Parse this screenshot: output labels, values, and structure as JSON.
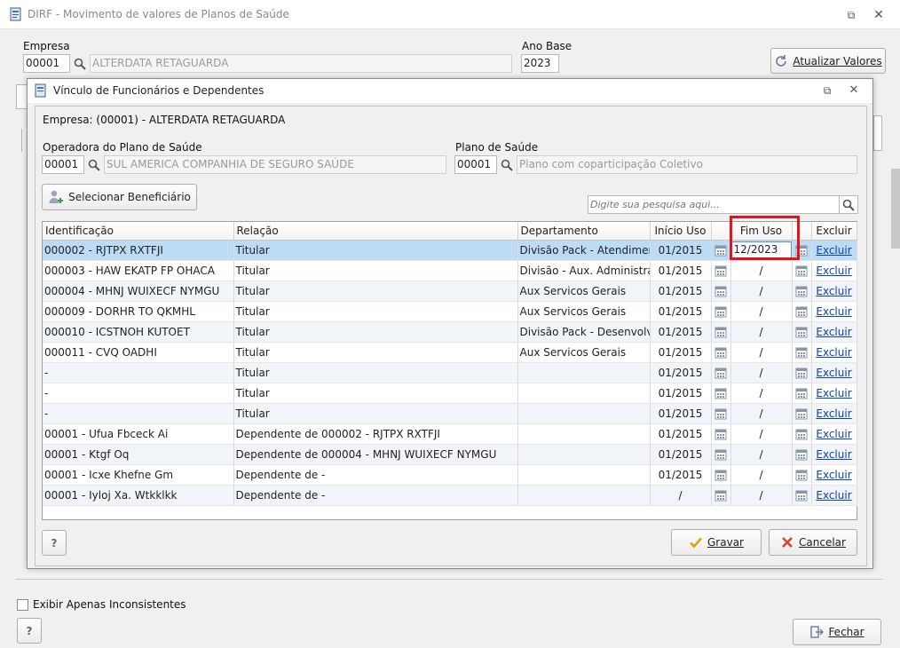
{
  "window": {
    "title": "DIRF - Movimento de valores de Planos de Saúde"
  },
  "main": {
    "empresa_label": "Empresa",
    "empresa_code": "00001",
    "empresa_name": "ALTERDATA RETAGUARDA",
    "ano_base_label": "Ano Base",
    "ano_base_value": "2023",
    "atualizar_label": "Atualizar Valores",
    "exibir_label": "Exibir Apenas Inconsistentes",
    "help_label": "?",
    "fechar_label": "Fechar"
  },
  "dialog": {
    "title": "Vínculo de Funcionários e Dependentes",
    "empresa_info": "Empresa: (00001) - ALTERDATA RETAGUARDA",
    "operadora_label": "Operadora do Plano de Saúde",
    "operadora_code": "00001",
    "operadora_name": "SUL AMERICA COMPANHIA DE SEGURO SAÚDE",
    "plano_label": "Plano de Saúde",
    "plano_code": "00001",
    "plano_name": "Plano com coparticipação Coletivo",
    "selecionar_label": "Selecionar Beneficiário",
    "search_placeholder": "Digite sua pesquisa aqui...",
    "help_label": "?",
    "gravar_label": "Gravar",
    "cancelar_label": "Cancelar"
  },
  "grid": {
    "columns": [
      "Identificação",
      "Relação",
      "Departamento",
      "Início Uso",
      "Fim Uso",
      "Excluir"
    ],
    "rows": [
      {
        "id": "000002 - RJTPX RXTFJI",
        "rel": "Titular",
        "dep": "Divisão Pack - Atendimento",
        "ini": "01/2015",
        "fim": "12/2023",
        "exc": "Excluir"
      },
      {
        "id": "000003 - HAW EKATP FP OHACA",
        "rel": "Titular",
        "dep": "Divisão - Aux. Administrativo",
        "ini": "01/2015",
        "fim": "/",
        "exc": "Excluir"
      },
      {
        "id": "000004 - MHNJ WUIXECF NYMGU",
        "rel": "Titular",
        "dep": "Aux Servicos Gerais",
        "ini": "01/2015",
        "fim": "/",
        "exc": "Excluir"
      },
      {
        "id": "000009 - DORHR TO QKMHL",
        "rel": "Titular",
        "dep": "Aux Servicos Gerais",
        "ini": "01/2015",
        "fim": "/",
        "exc": "Excluir"
      },
      {
        "id": "000010 - ICSTNOH KUTOET",
        "rel": "Titular",
        "dep": "Divisão Pack - Desenvolvimento",
        "ini": "01/2015",
        "fim": "/",
        "exc": "Excluir"
      },
      {
        "id": "000011 - CVQ OADHI",
        "rel": "Titular",
        "dep": "Aux Servicos Gerais",
        "ini": "01/2015",
        "fim": "/",
        "exc": "Excluir"
      },
      {
        "id": "-",
        "rel": "Titular",
        "dep": "",
        "ini": "01/2015",
        "fim": "/",
        "exc": "Excluir"
      },
      {
        "id": "-",
        "rel": "Titular",
        "dep": "",
        "ini": "01/2015",
        "fim": "/",
        "exc": "Excluir"
      },
      {
        "id": "-",
        "rel": "Titular",
        "dep": "",
        "ini": "01/2015",
        "fim": "/",
        "exc": "Excluir"
      },
      {
        "id": "00001 - Ufua Fbceck Ai",
        "rel": "Dependente de 000002 - RJTPX RXTFJI",
        "dep": "",
        "ini": "01/2015",
        "fim": "/",
        "exc": "Excluir"
      },
      {
        "id": "00001 - Ktgf Oq",
        "rel": "Dependente de 000004 - MHNJ WUIXECF NYMGU",
        "dep": "",
        "ini": "01/2015",
        "fim": "/",
        "exc": "Excluir"
      },
      {
        "id": "00001 - Icxe Khefne Gm",
        "rel": "Dependente de  -",
        "dep": "",
        "ini": "01/2015",
        "fim": "/",
        "exc": "Excluir"
      },
      {
        "id": "00001 - Iyloj Xa. Wtkklkk",
        "rel": "Dependente de  -",
        "dep": "",
        "ini": "/",
        "fim": "/",
        "exc": "Excluir"
      }
    ]
  }
}
